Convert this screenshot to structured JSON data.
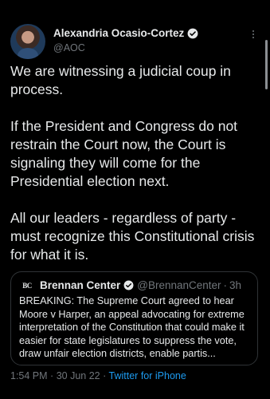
{
  "author": {
    "name": "Alexandria Ocasio-Cortez",
    "handle": "@AOC"
  },
  "tweet": {
    "paragraphs": [
      "We are witnessing a judicial coup in process.",
      "If the President and Congress do not restrain the Court now, the Court is signaling they will come for the Presidential election next.",
      "All our leaders - regardless of party - must recognize this Constitutional crisis for what it is."
    ]
  },
  "quoted": {
    "logo": "BC",
    "name": "Brennan Center",
    "handle": "@BrennanCenter",
    "separator": "·",
    "time": "3h",
    "text": "BREAKING: The Supreme Court agreed to hear Moore v Harper, an appeal advocating for extreme interpretation of the Constitution that could make it easier for state legislatures to suppress the vote, draw unfair election districts, enable partis..."
  },
  "meta": {
    "time": "1:54 PM",
    "separator": "·",
    "date": "30 Jun 22",
    "source": "Twitter for iPhone"
  },
  "colors": {
    "background": "#000000",
    "text": "#e7e9ea",
    "muted": "#71767b",
    "link": "#1d9bf0",
    "verified": "#1d9bf0"
  },
  "icons": [
    "verified-badge-icon",
    "more-options-icon",
    "brennan-center-logo"
  ]
}
